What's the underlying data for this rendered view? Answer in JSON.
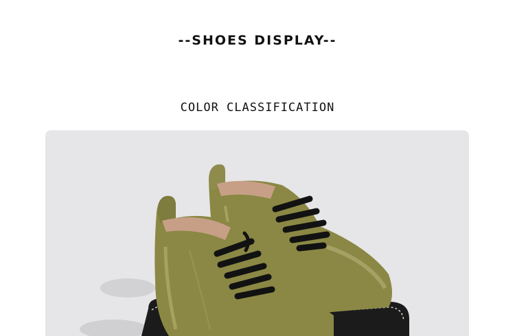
{
  "page": {
    "title": "--SHOES DISPLAY--",
    "subtitle": "COLOR CLASSIFICATION"
  },
  "photo": {
    "subject": "olive green lace-up ankle boots",
    "colors": {
      "background": "#e6e6e8",
      "leather": "#8a8844",
      "leather_highlight": "#b2ad6a",
      "lining": "#c79f86",
      "laces": "#121212",
      "sole": "#1b1b1b",
      "stitching": "#d8d6cf"
    }
  }
}
